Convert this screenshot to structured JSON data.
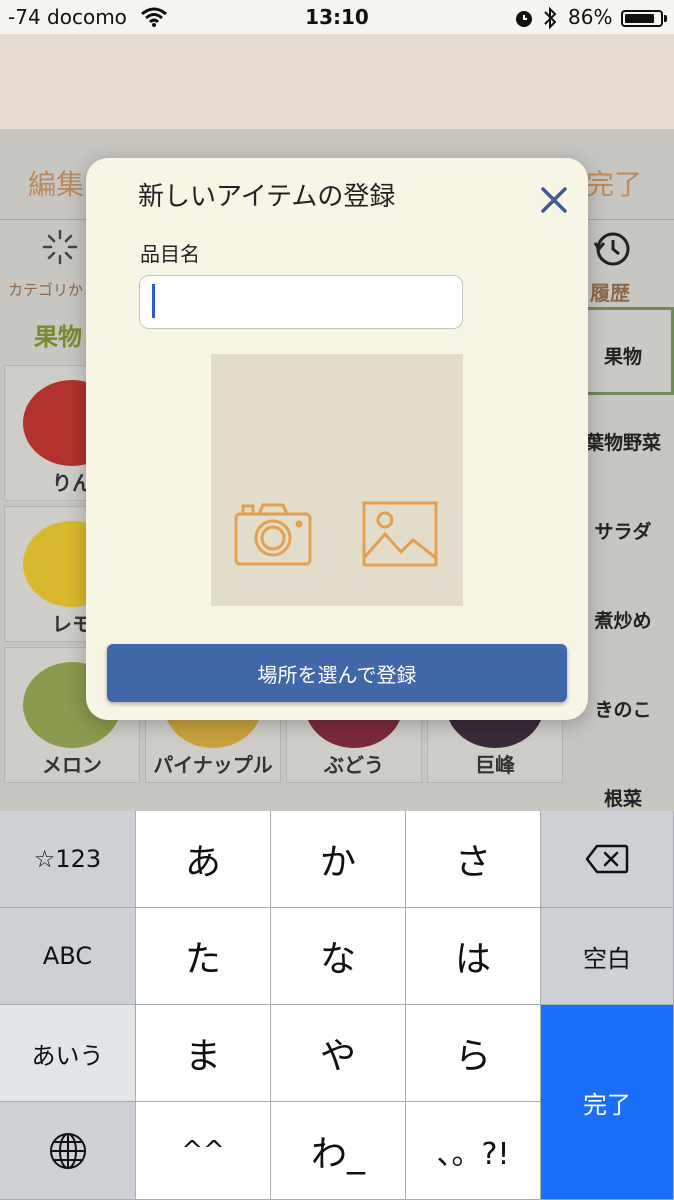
{
  "status_bar": {
    "carrier": "-74 docomo",
    "time": "13:10",
    "battery_percent_label": "86%",
    "battery_level": 0.86,
    "icons": [
      "wifi-icon",
      "alarm-icon",
      "bluetooth-icon",
      "battery-icon"
    ]
  },
  "background_app": {
    "edit_label": "編集",
    "done_label": "完了",
    "category_label": "カテゴリか",
    "history_label": "履歴",
    "section_title": "果物",
    "grid_items": [
      {
        "label": "りん",
        "color": "#b3322d"
      },
      {
        "label": "",
        "color": "#cfcdc8"
      },
      {
        "label": "",
        "color": "#cfcdc8"
      },
      {
        "label": "",
        "color": "#cfcdc8"
      },
      {
        "label": "レモ",
        "color": "#d8b92d"
      },
      {
        "label": "",
        "color": "#cfcdc8"
      },
      {
        "label": "",
        "color": "#cfcdc8"
      },
      {
        "label": "",
        "color": "#cfcdc8"
      },
      {
        "label": "メロン",
        "color": "#8a9a4e"
      },
      {
        "label": "パイナップル",
        "color": "#c9a23e"
      },
      {
        "label": "ぶどう",
        "color": "#7a2a3a"
      },
      {
        "label": "巨峰",
        "color": "#3a2a3a"
      }
    ],
    "side_categories": [
      "果物",
      "葉物野菜",
      "サラダ",
      "煮炒め",
      "きのこ",
      "根菜"
    ]
  },
  "modal": {
    "title": "新しいアイテムの登録",
    "field_label": "品目名",
    "name_value": "",
    "register_button": "場所を選んで登録",
    "accent_color": "#e4a04f",
    "icons": [
      "close-icon",
      "camera-icon",
      "image-icon"
    ]
  },
  "keyboard": {
    "row1": [
      "☆123",
      "あ",
      "か",
      "さ",
      ""
    ],
    "row2": [
      "ABC",
      "た",
      "な",
      "は",
      "空白"
    ],
    "row3": [
      "あいう",
      "ま",
      "や",
      "ら",
      "完了"
    ],
    "row4": [
      "",
      "^^",
      "わ_",
      "、。?!"
    ],
    "icons": [
      "delete-icon",
      "globe-icon"
    ]
  }
}
